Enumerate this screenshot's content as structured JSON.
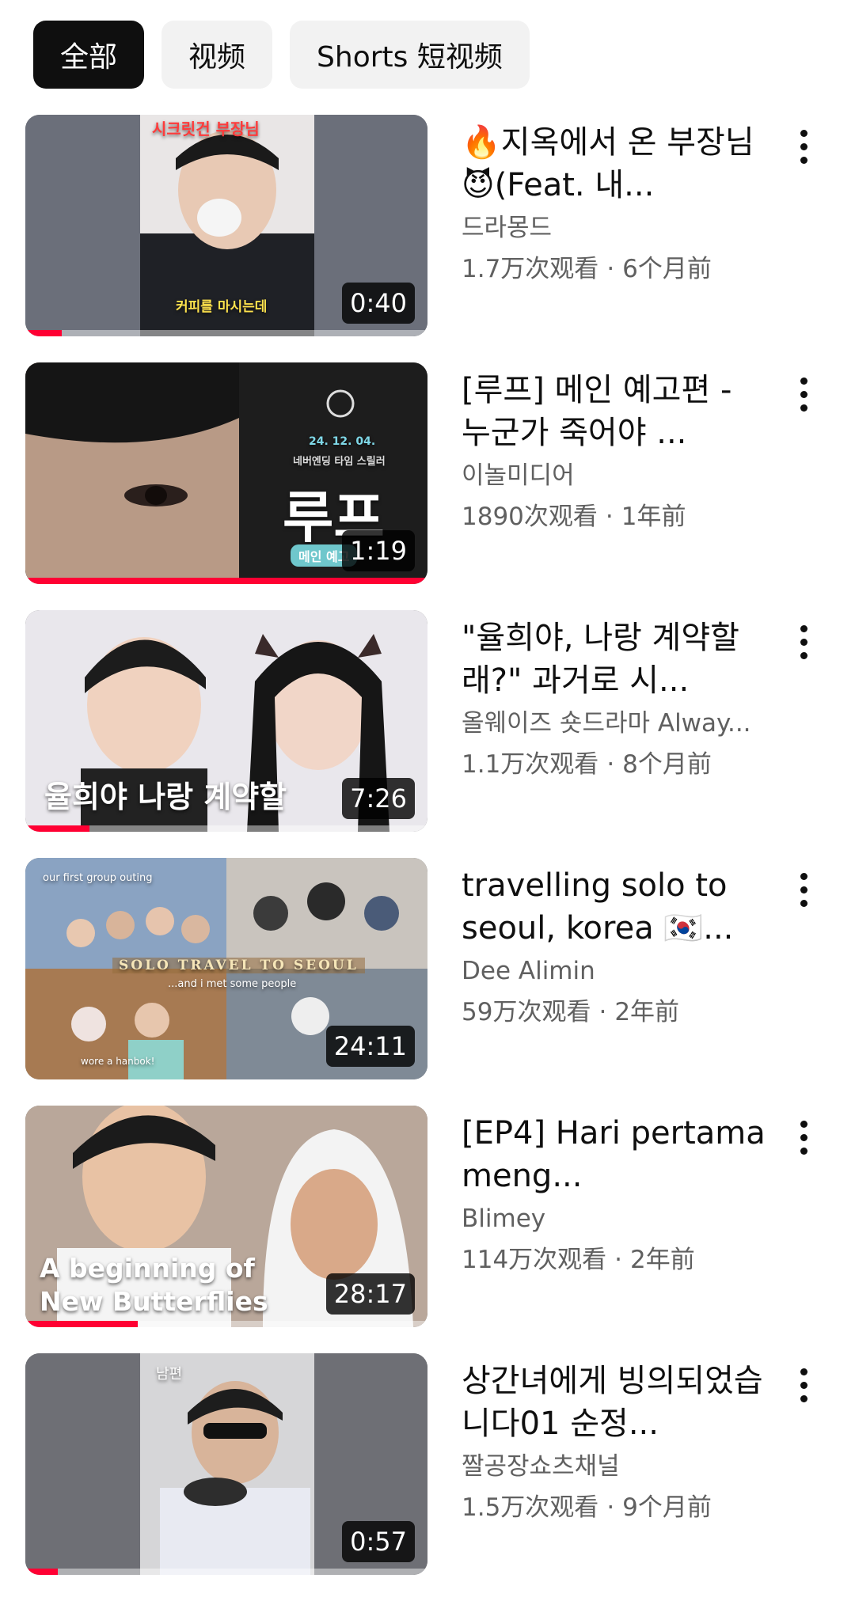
{
  "chips": [
    {
      "label": "全部",
      "active": true
    },
    {
      "label": "视频",
      "active": false
    },
    {
      "label": "Shorts 短视频",
      "active": false
    }
  ],
  "videos": [
    {
      "title": "🔥지옥에서 온 부장님😈(Feat. 내...",
      "channel": "드라몽드",
      "views": "1.7万次观看",
      "age": "6个月前",
      "duration": "0:40",
      "overlay_top": "시크릿건 부장님",
      "overlay_bottom": "커피를 마시는데",
      "progress": 0.09
    },
    {
      "title": "[루프] 메인 예고편 - 누군가 죽어야 ...",
      "channel": "이놀미디어",
      "views": "1890次观看",
      "age": "1年前",
      "duration": "1:19",
      "overlay_date": "24. 12. 04.",
      "overlay_sub": "네버엔딩 타임 스릴러",
      "overlay_big": "루프",
      "overlay_tag": "메인 예고",
      "progress": 1.0
    },
    {
      "title": "\"율희야, 나랑 계약할래?\" 과거로 시...",
      "channel": "올웨이즈 숏드라마 Alway...",
      "views": "1.1万次观看",
      "age": "8个月前",
      "duration": "7:26",
      "overlay_bottom": "율희야 나랑 계약할",
      "progress": 0.16
    },
    {
      "title": "travelling solo to seoul, korea 🇰🇷...",
      "channel": "Dee Alimin",
      "views": "59万次观看",
      "age": "2年前",
      "duration": "24:11",
      "overlay_top": "our first group outing",
      "overlay_banner": "SOLO TRAVEL TO SEOUL",
      "overlay_sub": "...and i met some people",
      "overlay_caption": "wore a hanbok!",
      "progress": 0
    },
    {
      "title": "[EP4] Hari pertama meng...",
      "channel": "Blimey",
      "views": "114万次观看",
      "age": "2年前",
      "duration": "28:17",
      "overlay_line1": "A beginning of",
      "overlay_line2": "New Butterflies",
      "progress": 0.28
    },
    {
      "title": "상간녀에게 빙의되었습니다01 순정...",
      "channel": "짤공장쇼츠채널",
      "views": "1.5万次观看",
      "age": "9个月前",
      "duration": "0:57",
      "overlay_top": "남편",
      "progress": 0.08
    }
  ]
}
